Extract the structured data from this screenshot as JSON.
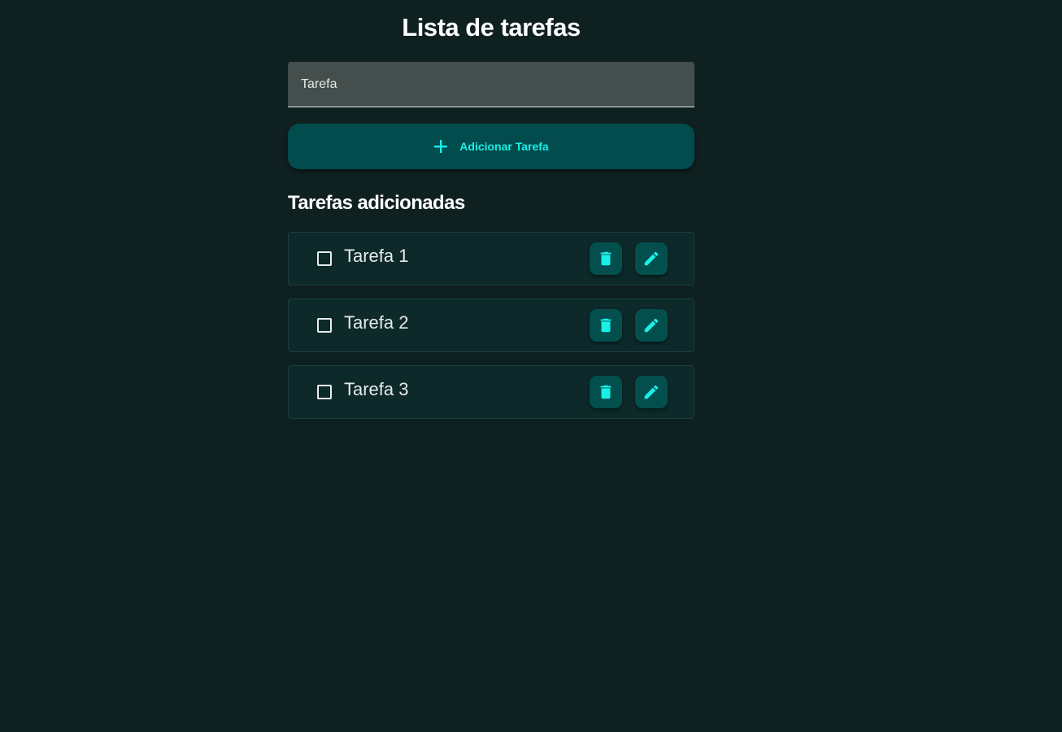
{
  "page": {
    "title": "Lista de tarefas"
  },
  "task_input": {
    "placeholder": "Tarefa",
    "value": ""
  },
  "add_button": {
    "label": "Adicionar Tarefa",
    "icon": "plus-icon"
  },
  "list_section": {
    "title": "Tarefas adicionadas"
  },
  "tasks": [
    {
      "label": "Tarefa 1",
      "checked": false
    },
    {
      "label": "Tarefa 2",
      "checked": false
    },
    {
      "label": "Tarefa 3",
      "checked": false
    }
  ],
  "icons": {
    "delete": "trash-icon",
    "edit": "pencil-icon"
  },
  "colors": {
    "background": "#0f2021",
    "accent": "#19f0e6",
    "button_bg": "#024c4d",
    "card_bg": "#0d2929"
  }
}
